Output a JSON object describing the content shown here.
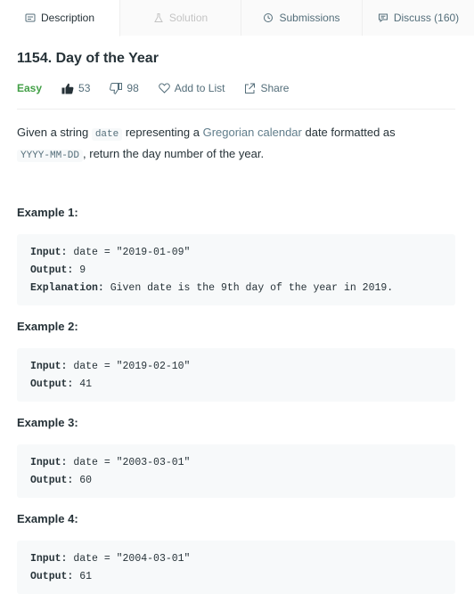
{
  "tabs": [
    {
      "label": "Description",
      "icon": "description-icon"
    },
    {
      "label": "Solution",
      "icon": "flask-icon"
    },
    {
      "label": "Submissions",
      "icon": "clock-icon"
    },
    {
      "label": "Discuss (160)",
      "icon": "discuss-icon"
    }
  ],
  "problem": {
    "title": "1154. Day of the Year",
    "difficulty": "Easy",
    "likes": "53",
    "dislikes": "98",
    "add_to_list": "Add to List",
    "share": "Share"
  },
  "description": {
    "p1_a": "Given a string ",
    "p1_code": "date",
    "p1_b": " representing a ",
    "p1_link": "Gregorian calendar",
    "p1_c": " date formatted as ",
    "p1_code2": "YYYY-MM-DD",
    "p1_d": ", return the day number of the year."
  },
  "examples": [
    {
      "title": "Example 1:",
      "input_label": "Input:",
      "input": " date = \"2019-01-09\"",
      "output_label": "Output:",
      "output": " 9",
      "explanation_label": "Explanation:",
      "explanation": " Given date is the 9th day of the year in 2019."
    },
    {
      "title": "Example 2:",
      "input_label": "Input:",
      "input": " date = \"2019-02-10\"",
      "output_label": "Output:",
      "output": " 41"
    },
    {
      "title": "Example 3:",
      "input_label": "Input:",
      "input": " date = \"2003-03-01\"",
      "output_label": "Output:",
      "output": " 60"
    },
    {
      "title": "Example 4:",
      "input_label": "Input:",
      "input": " date = \"2004-03-01\"",
      "output_label": "Output:",
      "output": " 61"
    }
  ],
  "colors": {
    "easy": "#43a047",
    "code_bg": "#f7f9fa",
    "text": "#263238",
    "muted": "#546e7a"
  }
}
